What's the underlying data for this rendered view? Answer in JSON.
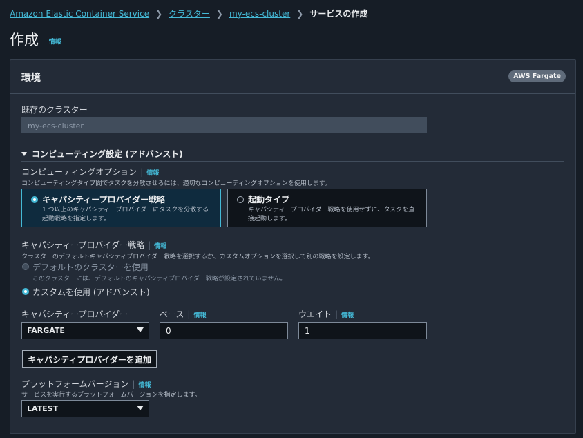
{
  "breadcrumb": {
    "items": [
      "Amazon Elastic Container Service",
      "クラスター",
      "my-ecs-cluster"
    ],
    "current": "サービスの作成"
  },
  "page": {
    "title": "作成",
    "info": "情報"
  },
  "environment": {
    "title": "環境",
    "badge": "AWS Fargate",
    "existing_cluster": {
      "label": "既存のクラスター",
      "value": "my-ecs-cluster"
    },
    "compute_settings": {
      "toggle_label": "コンピューティング設定 (アドバンスト)",
      "option_label": "コンピューティングオプション",
      "option_info": "情報",
      "option_desc": "コンピューティングタイプ間でタスクを分散させるには、適切なコンピューティングオプションを使用します。",
      "options": [
        {
          "title": "キャパシティープロバイダー戦略",
          "desc": "1 つ以上のキャパシティープロバイダーにタスクを分散する起動戦略を指定します。",
          "selected": true
        },
        {
          "title": "起動タイプ",
          "desc": "キャパシティープロバイダー戦略を使用せずに、タスクを直接起動します。",
          "selected": false
        }
      ]
    },
    "strategy": {
      "label": "キャパシティープロバイダー戦略",
      "info": "情報",
      "desc": "クラスターのデフォルトキャパシティプロバイダー戦略を選択するか、カスタムオプションを選択して別の戦略を設定します。",
      "default_option": {
        "label": "デフォルトのクラスターを使用",
        "desc": "このクラスターには、デフォルトのキャパシティプロバイダー戦略が設定されていません。"
      },
      "custom_option": {
        "label": "カスタムを使用 (アドバンスト)"
      }
    },
    "provider": {
      "label": "キャパシティープロバイダー",
      "value": "FARGATE",
      "base_label": "ベース",
      "base_info": "情報",
      "base_value": "0",
      "weight_label": "ウエイト",
      "weight_info": "情報",
      "weight_value": "1",
      "add_button": "キャパシティプロバイダーを追加"
    },
    "platform": {
      "label": "プラットフォームバージョン",
      "info": "情報",
      "desc": "サービスを実行するプラットフォームバージョンを指定します。",
      "value": "LATEST"
    }
  }
}
